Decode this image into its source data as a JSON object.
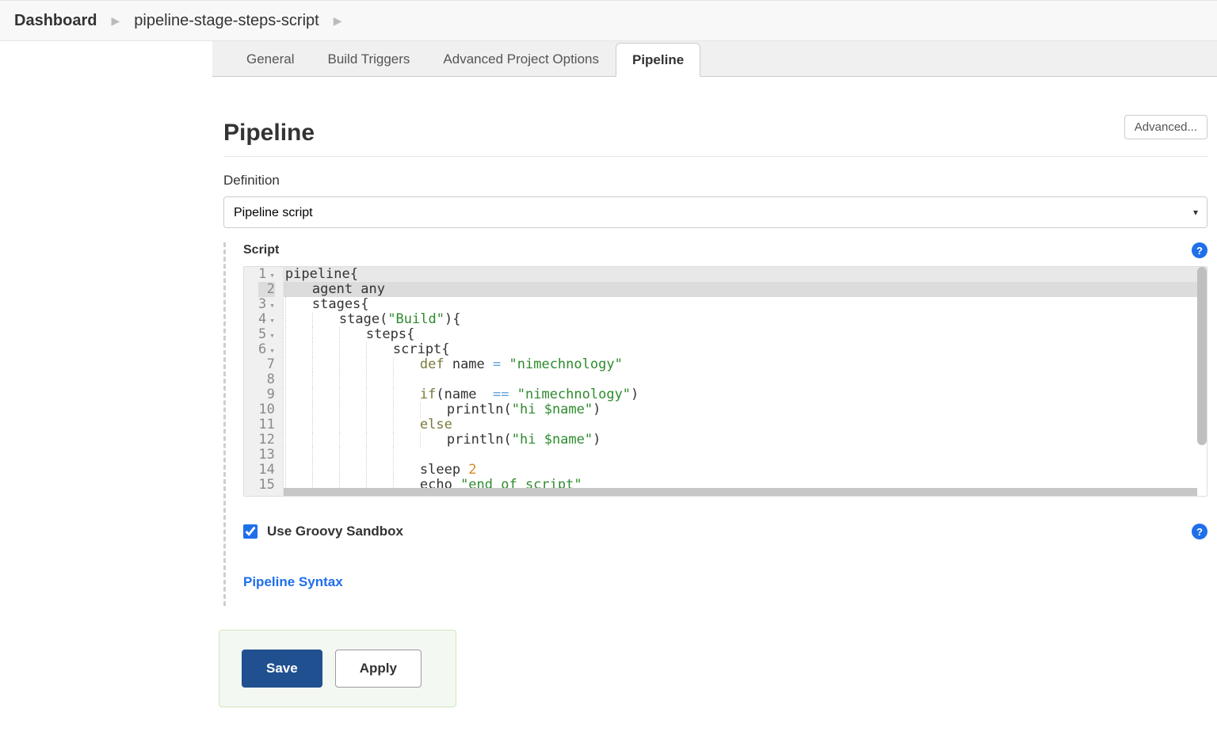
{
  "breadcrumb": {
    "dashboard": "Dashboard",
    "project": "pipeline-stage-steps-script"
  },
  "tabs": {
    "general": "General",
    "build_triggers": "Build Triggers",
    "advanced": "Advanced Project Options",
    "pipeline": "Pipeline"
  },
  "advanced_btn": "Advanced...",
  "section": {
    "title": "Pipeline",
    "definition_label": "Definition",
    "definition_value": "Pipeline script"
  },
  "script": {
    "label": "Script",
    "lines": [
      {
        "n": "1",
        "fold": true
      },
      {
        "n": "2",
        "fold": false,
        "hl": true
      },
      {
        "n": "3",
        "fold": true
      },
      {
        "n": "4",
        "fold": true
      },
      {
        "n": "5",
        "fold": true
      },
      {
        "n": "6",
        "fold": true
      },
      {
        "n": "7",
        "fold": false
      },
      {
        "n": "8",
        "fold": false
      },
      {
        "n": "9",
        "fold": false
      },
      {
        "n": "10",
        "fold": false
      },
      {
        "n": "11",
        "fold": false
      },
      {
        "n": "12",
        "fold": false
      },
      {
        "n": "13",
        "fold": false
      },
      {
        "n": "14",
        "fold": false
      },
      {
        "n": "15",
        "fold": false
      }
    ],
    "code": {
      "l1_a": "pipeline",
      "l1_b": "{",
      "l2_a": "agent any",
      "l3_a": "stages",
      "l3_b": "{",
      "l4_a": "stage",
      "l4_b": "(",
      "l4_c": "\"Build\"",
      "l4_d": ")",
      "l4_e": "{",
      "l5_a": "steps",
      "l5_b": "{",
      "l6_a": "script",
      "l6_b": "{",
      "l7_a": "def",
      "l7_b": " name ",
      "l7_c": "=",
      "l7_d": " ",
      "l7_e": "\"nimechnology\"",
      "l9_a": "if",
      "l9_b": "(name  ",
      "l9_c": "==",
      "l9_d": " ",
      "l9_e": "\"nimechnology\"",
      "l9_f": ")",
      "l10_a": "println(",
      "l10_b": "\"hi $name\"",
      "l10_c": ")",
      "l11_a": "else",
      "l12_a": "println(",
      "l12_b": "\"hi $name\"",
      "l12_c": ")",
      "l14_a": "sleep ",
      "l14_b": "2",
      "l15_a": "echo ",
      "l15_b": "\"end of script\""
    }
  },
  "sandbox": {
    "label": "Use Groovy Sandbox"
  },
  "pipeline_syntax": "Pipeline Syntax",
  "buttons": {
    "save": "Save",
    "apply": "Apply"
  },
  "help_glyph": "?"
}
